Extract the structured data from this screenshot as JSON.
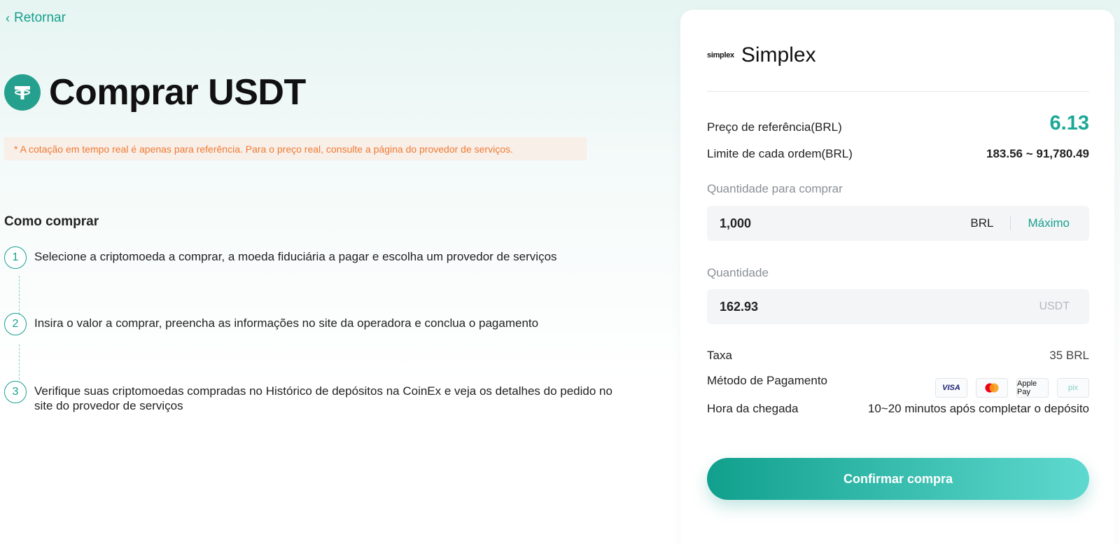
{
  "nav": {
    "back_label": "Retornar"
  },
  "header": {
    "title": "Comprar USDT"
  },
  "notice": "* A cotação em tempo real é apenas para referência. Para o preço real, consulte a página do provedor de serviços.",
  "how_to": {
    "title": "Como comprar",
    "steps": [
      {
        "num": "1",
        "text": "Selecione a criptomoeda a comprar, a moeda fiduciária a pagar e escolha um provedor de serviços"
      },
      {
        "num": "2",
        "text": "Insira o valor a comprar, preencha as informações no site da operadora e conclua o pagamento"
      },
      {
        "num": "3",
        "text": "Verifique suas criptomoedas compradas no Histórico de depósitos na CoinEx e veja os detalhes do pedido no site do provedor de serviços"
      }
    ]
  },
  "provider": {
    "logo_text": "simplex",
    "name": "Simplex"
  },
  "quote": {
    "ref_price_label": "Preço de referência(BRL)",
    "ref_price_value": "6.13",
    "limit_label": "Limite de cada ordem(BRL)",
    "limit_value": "183.56 ~ 91,780.49"
  },
  "buy_amount": {
    "label": "Quantidade para comprar",
    "value": "1,000",
    "unit": "BRL",
    "max_label": "Máximo"
  },
  "receive_amount": {
    "label": "Quantidade",
    "value": "162.93",
    "unit": "USDT"
  },
  "details": {
    "fee_label": "Taxa",
    "fee_value": "35 BRL",
    "payment_label": "Método de Pagamento",
    "payment_methods": [
      "VISA",
      "mastercard",
      "Apple Pay",
      "pix"
    ],
    "arrival_label": "Hora da chegada",
    "arrival_value": "10~20 minutos após completar o depósito"
  },
  "confirm_label": "Confirmar compra",
  "colors": {
    "accent": "#17a08e",
    "notice": "#f07a33",
    "ref_price": "#1aa897"
  }
}
